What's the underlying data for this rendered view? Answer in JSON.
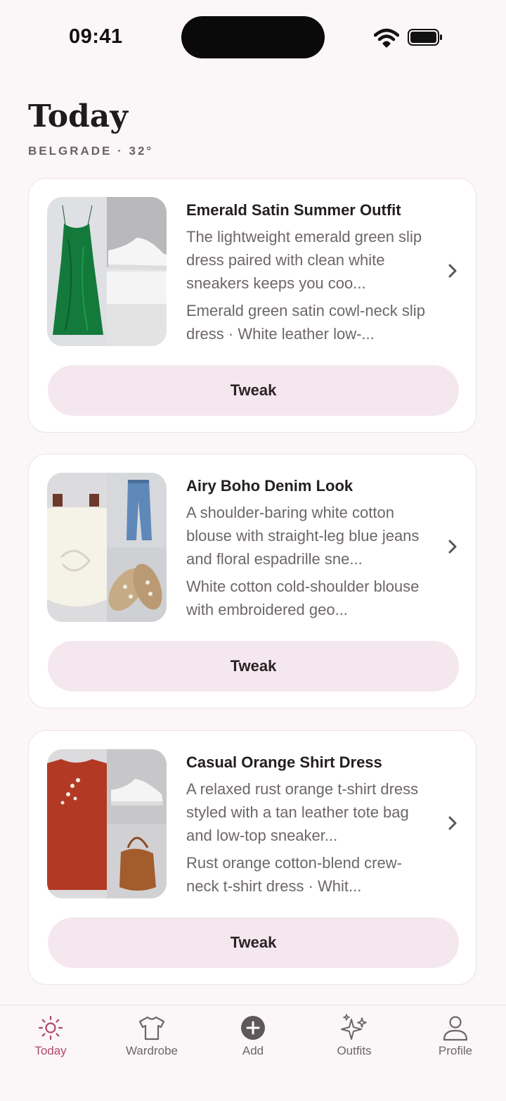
{
  "status_bar": {
    "time": "09:41"
  },
  "header": {
    "title": "Today",
    "subtitle": "BELGRADE · 32°"
  },
  "colors": {
    "accent": "#b0466e",
    "tweak_bg": "#f4e8ee",
    "background": "#fbf6f7"
  },
  "outfits": [
    {
      "title": "Emerald Satin Summer Outfit",
      "description": "The lightweight emerald green slip dress paired with clean white sneakers keeps you coo...",
      "items": "Emerald green satin cowl-neck slip dress · White leather low-...",
      "button_label": "Tweak"
    },
    {
      "title": "Airy Boho Denim Look",
      "description": "A shoulder-baring white cotton blouse with straight-leg blue jeans and floral espadrille sne...",
      "items": "White cotton cold-shoulder blouse with embroidered geo...",
      "button_label": "Tweak"
    },
    {
      "title": "Casual Orange Shirt Dress",
      "description": "A relaxed rust orange t-shirt dress styled with a tan leather tote bag and low-top sneaker...",
      "items": "Rust orange cotton-blend crew-neck t-shirt dress · Whit...",
      "button_label": "Tweak"
    }
  ],
  "tab_bar": {
    "tabs": [
      {
        "label": "Today",
        "icon": "sun-icon",
        "active": true
      },
      {
        "label": "Wardrobe",
        "icon": "tshirt-icon",
        "active": false
      },
      {
        "label": "Add",
        "icon": "plus-circle-icon",
        "active": false
      },
      {
        "label": "Outfits",
        "icon": "sparkles-icon",
        "active": false
      },
      {
        "label": "Profile",
        "icon": "person-icon",
        "active": false
      }
    ]
  }
}
